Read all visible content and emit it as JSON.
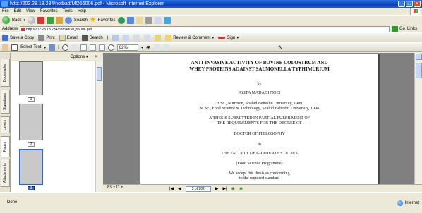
{
  "window": {
    "title": "http://202.28.18.234/notbad/MQ56006.pdf - Microsoft Internet Explorer",
    "min_glyph": "_",
    "max_glyph": "□",
    "close_glyph": "×"
  },
  "menu": [
    "File",
    "Edit",
    "View",
    "Favorites",
    "Tools",
    "Help"
  ],
  "ie_toolbar": {
    "back_label": "Back",
    "search_label": "Search",
    "favorites_label": "Favorites"
  },
  "address": {
    "label": "Address",
    "url": "http://202.28.18.234/notbad/MQ56006.pdf",
    "go_label": "Go",
    "links_label": "Links"
  },
  "acrobat_toolbar1": {
    "save_label": "Save a Copy",
    "print_label": "Print",
    "email_label": "Email",
    "search_label": "Search",
    "review_label": "Review & Comment",
    "sign_label": "Sign"
  },
  "acrobat_toolbar2": {
    "select_text_label": "Select Text",
    "zoom_value": "82%"
  },
  "side_tabs": [
    "Bookmarks",
    "Signatures",
    "Layers",
    "Pages",
    "Attachments"
  ],
  "thumbnails": {
    "options_label": "Options",
    "close_glyph": "×",
    "pages": [
      {
        "label": "1",
        "selected": false
      },
      {
        "label": "2",
        "selected": false
      },
      {
        "label": "3",
        "selected": true
      }
    ]
  },
  "document": {
    "title_line1": "ANTI-INVASIVE ACTIVITY OF BOVINE COLOSTRUM AND",
    "title_line2": "WHEY PROTEINS AGAINST SALMONELLA TYPHIMURIUM",
    "by": "by",
    "author": "AZITA MADADI NOEI",
    "degree1": "B.Sc., Nutrition, Shahid Beheshti University, 1989",
    "degree2": "M.Sc., Food Science & Technology, Shahid Beheshti University, 1994",
    "thesis1": "A THESIS SUBMITTED IN PARTIAL FULFILMENT OF",
    "thesis2": "THE REQUIREMENTS FOR THE DEGREE OF",
    "doctor": "DOCTOR OF PHILOSOPHY",
    "in": "in",
    "faculty": "THE FACULTY OF GRADUATE STUDIES",
    "programme": "(Food Science Programme)",
    "accept1": "We accept this thesis as conforming",
    "accept2": "to the required standard"
  },
  "navigation": {
    "page_size": "8.5 x 11 in",
    "page_indicator": "3 of 202"
  },
  "status": {
    "left": "Done",
    "zone": "Internet"
  }
}
